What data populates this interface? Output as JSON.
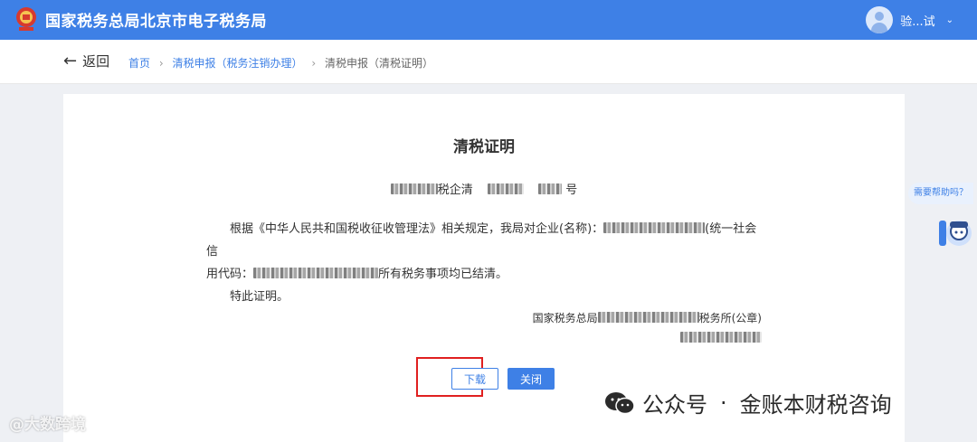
{
  "header": {
    "site_title": "国家税务总局北京市电子税务局",
    "user_name": "验...试",
    "dropdown_glyph": "⌄"
  },
  "nav": {
    "back_label": "返回",
    "back_glyph": "←",
    "breadcrumb": [
      "首页",
      "清税申报（税务注销办理）",
      "清税申报（清税证明）"
    ],
    "breadcrumb_sep": "›"
  },
  "certificate": {
    "title": "清税证明",
    "number_mid": "税企清",
    "number_suffix": "号",
    "para1_a": "根据《中华人民共和国税收征收管理法》相关规定，我局对企业(名称)：",
    "para1_b": "(统一社会信",
    "para1_c": "用代码：",
    "para1_d": "所有税务事项均已结清。",
    "para2": "特此证明。",
    "sign_prefix": "国家税务总局",
    "sign_suffix": "税务所(公章)"
  },
  "buttons": {
    "download": "下载",
    "close": "关闭"
  },
  "help": {
    "label": "需要帮助吗？"
  },
  "watermarks": {
    "left": "@大数跨境",
    "right_a": "公众号",
    "right_dot": "·",
    "right_b": "金账本财税咨询"
  },
  "colors": {
    "primary": "#3e80e6",
    "highlight_box": "#e02020"
  }
}
